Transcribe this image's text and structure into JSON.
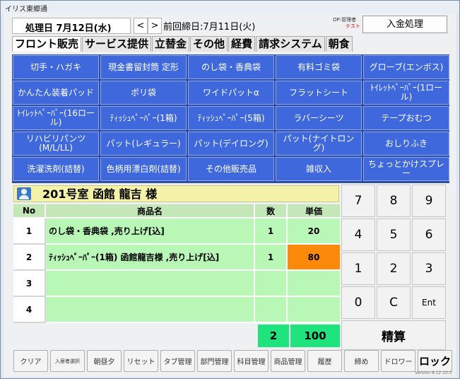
{
  "window": {
    "title": "イリス東郷通"
  },
  "header": {
    "date": "処理日 7月12日(水)",
    "prev_arrow": "<",
    "next_arrow": ">",
    "prev_close": "前回締日:7月11日(火)",
    "operator_label": "OP:管理者",
    "operator_name": "テスト",
    "deposit_button": "入金処理"
  },
  "tabs": [
    {
      "label": "フロント販売",
      "active": true
    },
    {
      "label": "サービス提供",
      "active": false
    },
    {
      "label": "立替金",
      "active": false
    },
    {
      "label": "その他",
      "active": false
    },
    {
      "label": "経費",
      "active": false
    },
    {
      "label": "請求システム",
      "active": false
    },
    {
      "label": "朝食",
      "active": false
    }
  ],
  "products": [
    "切手・ハガキ",
    "現金書留封筒 定形",
    "のし袋・香典袋",
    "有料ゴミ袋",
    "グローブ(エンボス)",
    "かんたん装着パッド",
    "ポリ袋",
    "ワイドパットα",
    "フラットシート",
    "ﾄｲﾚｯﾄﾍﾟｰﾊﾟｰ(1ロール)",
    "ﾄｲﾚｯﾄﾍﾟｰﾊﾟｰ(16ロール)",
    "ﾃｨｯｼｭﾍﾟｰﾊﾟｰ(1箱)",
    "ﾃｨｯｼｭﾍﾟｰﾊﾟｰ(5箱)",
    "ラバーシーツ",
    "テープおむつ",
    "リハビリパンツ(M/L/LL)",
    "パット(レギュラー)",
    "パット(デイロング)",
    "パット(ナイトロング)",
    "おしりふき",
    "洗濯洗剤(詰替)",
    "色柄用漂白剤(詰替)",
    "その他販売品",
    "雑収入",
    "ちょっとかけスプレー"
  ],
  "customer": "201号室 函館 龍吉 様",
  "table": {
    "headers": {
      "no": "No",
      "name": "商品名",
      "qty": "数",
      "price": "単価"
    },
    "rows": [
      {
        "no": "1",
        "name": "のし袋・香典袋 ,売り上げ[込]",
        "qty": "1",
        "price": "20"
      },
      {
        "no": "2",
        "name": "ﾃｨｯｼｭﾍﾟｰﾊﾟｰ(1箱) 函館龍吉様 ,売り上げ[込]",
        "qty": "1",
        "price": "80"
      },
      {
        "no": "3",
        "name": "",
        "qty": "",
        "price": ""
      },
      {
        "no": "4",
        "name": "",
        "qty": "",
        "price": ""
      }
    ],
    "total_qty": "2",
    "total_price": "100"
  },
  "keypad": [
    "7",
    "8",
    "9",
    "4",
    "5",
    "6",
    "1",
    "2",
    "3",
    "0",
    "C",
    "Ent"
  ],
  "settle_button": "精算",
  "toolbar": [
    "クリア",
    "入居者選択",
    "朝昼夕",
    "リセット",
    "タブ管理",
    "部門管理",
    "科目管理",
    "商品管理",
    "履歴",
    "締め",
    "ドロワー",
    "ロック"
  ],
  "version": "Version 8.12.10.0",
  "colors": {
    "product_button": "#3e68dc",
    "row_fill": "#b8f7b5",
    "highlight": "#fb8a0a",
    "total_fill": "#1fe37c",
    "customer_banner": "#f4f1a8"
  }
}
